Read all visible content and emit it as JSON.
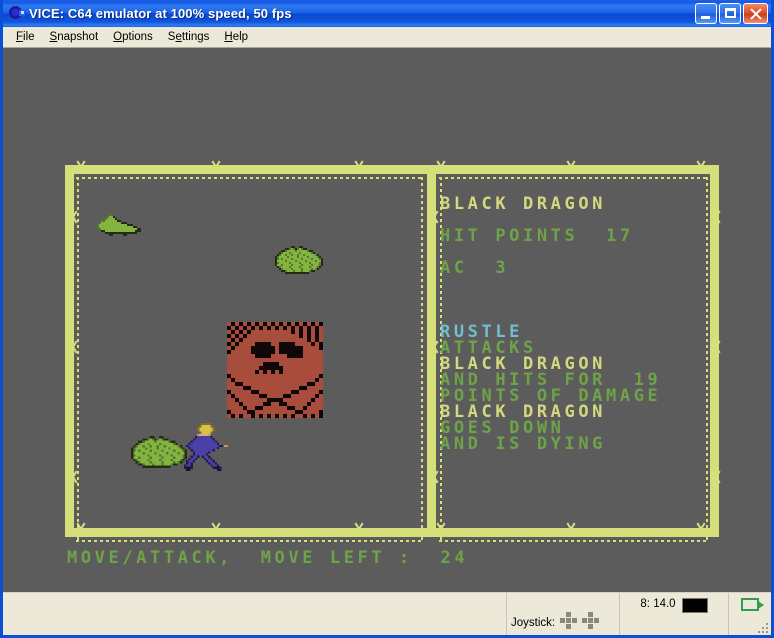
{
  "window": {
    "title": "VICE: C64 emulator at 100% speed, 50 fps",
    "icon": "vice-logo-icon",
    "controls": {
      "minimize": "minimize-button",
      "maximize": "maximize-button",
      "close": "close-button"
    }
  },
  "menubar": {
    "items": [
      {
        "label": "File",
        "accel": "F"
      },
      {
        "label": "Snapshot",
        "accel": "S"
      },
      {
        "label": "Options",
        "accel": "O"
      },
      {
        "label": "Settings",
        "accel": "e"
      },
      {
        "label": "Help",
        "accel": "H"
      }
    ]
  },
  "game": {
    "background_color": "#5c5c5c",
    "frame_color": "#d6e07a",
    "panels": {
      "map_panel": "map-viewport",
      "text_panel": "combat-log-panel"
    },
    "monster": {
      "name": "BLACK DRAGON",
      "hit_points_line": "HIT POINTS  17",
      "armor_class_line": "AC  3"
    },
    "combat_log": [
      {
        "text": "RUSTLE",
        "color": "cyan"
      },
      {
        "text": "ATTACKS",
        "color": "green"
      },
      {
        "text": "BLACK DRAGON",
        "color": "yellow"
      },
      {
        "text": "AND HITS FOR  19",
        "color": "green"
      },
      {
        "text": "POINTS OF DAMAGE",
        "color": "green"
      },
      {
        "text": "BLACK DRAGON",
        "color": "yellow"
      },
      {
        "text": "GOES DOWN",
        "color": "green"
      },
      {
        "text": "AND IS DYING",
        "color": "green"
      }
    ],
    "prompt": "MOVE/ATTACK,  MOVE LEFT :  24",
    "sprites": [
      {
        "name": "fallen-dragon-sprite",
        "desc": "green dying dragon"
      },
      {
        "name": "bush-sprite",
        "desc": "green foliage"
      },
      {
        "name": "skull-tile",
        "desc": "skull and crossbones"
      },
      {
        "name": "bush-sprite-2",
        "desc": "green foliage"
      },
      {
        "name": "player-character-sprite",
        "desc": "blonde fighter in blue"
      }
    ],
    "colors": {
      "yellow": "#d5d97e",
      "green": "#6fa348",
      "cyan": "#6fbfd0",
      "skull_red": "#a84d3c"
    }
  },
  "statusbar": {
    "joystick_label": "Joystick:",
    "joystick_ports": 2,
    "drive_label": "8: 14.0",
    "drive_led": "off",
    "tape_icon": "tape-icon"
  }
}
